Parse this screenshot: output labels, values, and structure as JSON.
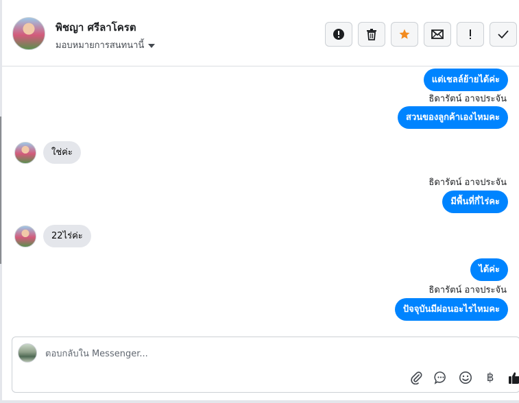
{
  "header": {
    "contact_name": "พิชญา ศรีลาโครต",
    "assign_label": "มอบหมายการสนทนานี้",
    "actions": [
      {
        "name": "report",
        "icon": "alert-circle-icon"
      },
      {
        "name": "delete",
        "icon": "trash-icon"
      },
      {
        "name": "star",
        "icon": "star-icon",
        "color": "#f28b20"
      },
      {
        "name": "mark-unread",
        "icon": "envelope-icon"
      },
      {
        "name": "mark-important",
        "icon": "exclamation-icon"
      },
      {
        "name": "mark-done",
        "icon": "checkmark-icon"
      }
    ]
  },
  "messages": [
    {
      "dir": "out",
      "text": "แต่เชลล์ย้ายได้ค่ะ"
    },
    {
      "dir": "out",
      "sender": "ธิดารัตน์ อาจประจัน",
      "text": "สวนของลูกค้าเองไหมคะ"
    },
    {
      "dir": "in",
      "text": "ใช่ค่ะ"
    },
    {
      "dir": "out",
      "sender": "ธิดารัตน์ อาจประจัน",
      "text": "มีพื้นที่กี่ไร่คะ"
    },
    {
      "dir": "in",
      "text": "22ไร่ค่ะ"
    },
    {
      "dir": "out",
      "text": "ได้ค่ะ"
    },
    {
      "dir": "out",
      "sender": "ธิดารัตน์ อาจประจัน",
      "text": "ปัจจุบันมีผ่อนอะไรไหมคะ"
    }
  ],
  "composer": {
    "placeholder": "ตอบกลับใน Messenger...",
    "value": "",
    "tools": [
      "paperclip-icon",
      "chat-bubble-icon",
      "smiley-icon",
      "baht-icon",
      "thumbs-up-icon"
    ],
    "currency_symbol": "฿"
  },
  "colors": {
    "outgoing_bubble": "#0084ff",
    "incoming_bubble": "#e4e6eb",
    "star": "#f28b20"
  }
}
